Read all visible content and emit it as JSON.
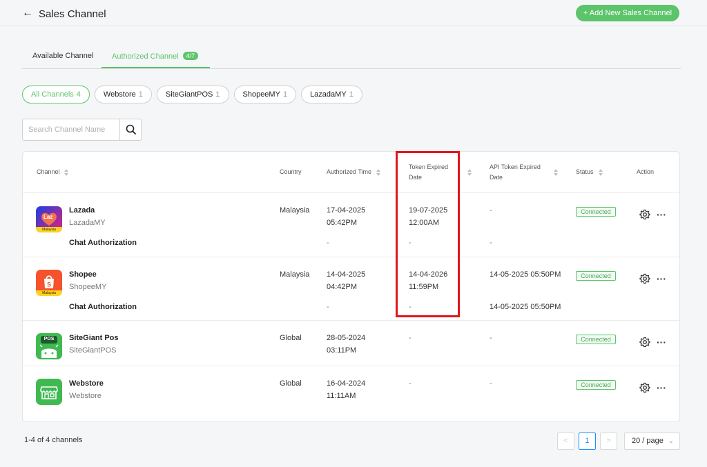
{
  "header": {
    "title": "Sales Channel",
    "add_button": "+ Add New Sales Channel"
  },
  "tabs": {
    "available": "Available Channel",
    "authorized": "Authorized Channel",
    "authorized_badge": "4/7"
  },
  "filters": [
    {
      "label": "All Channels",
      "count": "4",
      "active": true
    },
    {
      "label": "Webstore",
      "count": "1"
    },
    {
      "label": "SiteGiantPOS",
      "count": "1"
    },
    {
      "label": "ShopeeMY",
      "count": "1"
    },
    {
      "label": "LazadaMY",
      "count": "1"
    }
  ],
  "search": {
    "placeholder": "Search Channel Name"
  },
  "table": {
    "headers": {
      "channel": "Channel",
      "country": "Country",
      "authorized_time": "Authorized Time",
      "token_expired_line1": "Token Expired",
      "token_expired_line2": "Date",
      "api_token_line1": "API Token Expired",
      "api_token_line2": "Date",
      "status": "Status",
      "action": "Action"
    },
    "rows": [
      {
        "name": "Lazada",
        "sub": "LazadaMY",
        "country": "Malaysia",
        "auth_date": "17-04-2025",
        "auth_time": "05:42PM",
        "token_date": "19-07-2025",
        "token_time": "12:00AM",
        "api_token": "-",
        "status": "Connected",
        "chat_label": "Chat Authorization",
        "chat_auth": "-",
        "chat_token": "-",
        "chat_api": "-"
      },
      {
        "name": "Shopee",
        "sub": "ShopeeMY",
        "country": "Malaysia",
        "auth_date": "14-04-2025",
        "auth_time": "04:42PM",
        "token_date": "14-04-2026",
        "token_time": "11:59PM",
        "api_token": "14-05-2025 05:50PM",
        "status": "Connected",
        "chat_label": "Chat Authorization",
        "chat_auth": "-",
        "chat_token": "-",
        "chat_api": "14-05-2025 05:50PM"
      },
      {
        "name": "SiteGiant Pos",
        "sub": "SiteGiantPOS",
        "country": "Global",
        "auth_date": "28-05-2024",
        "auth_time": "03:11PM",
        "token_date": "-",
        "api_token": "-",
        "status": "Connected"
      },
      {
        "name": "Webstore",
        "sub": "Webstore",
        "country": "Global",
        "auth_date": "16-04-2024",
        "auth_time": "11:11AM",
        "token_date": "-",
        "api_token": "-",
        "status": "Connected"
      }
    ]
  },
  "logos": {
    "lazada_text": "Laz",
    "lazada_tag": "Malaysia",
    "shopee_tag": "Malaysia",
    "pos_text": "POS"
  },
  "footer": {
    "count_text": "1-4 of 4 channels",
    "prev": "<",
    "page": "1",
    "next": ">",
    "page_size": "20 / page"
  },
  "colors": {
    "accent": "#5cc46a",
    "highlight": "#e2141c",
    "pagination_active": "#1890ff"
  }
}
